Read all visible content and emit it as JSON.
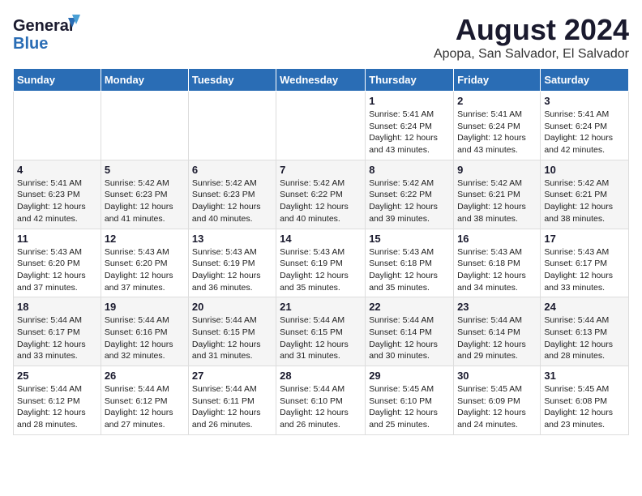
{
  "logo": {
    "line1": "General",
    "line2": "Blue"
  },
  "header": {
    "title": "August 2024",
    "location": "Apopa, San Salvador, El Salvador"
  },
  "weekdays": [
    "Sunday",
    "Monday",
    "Tuesday",
    "Wednesday",
    "Thursday",
    "Friday",
    "Saturday"
  ],
  "weeks": [
    [
      {
        "day": "",
        "info": ""
      },
      {
        "day": "",
        "info": ""
      },
      {
        "day": "",
        "info": ""
      },
      {
        "day": "",
        "info": ""
      },
      {
        "day": "1",
        "info": "Sunrise: 5:41 AM\nSunset: 6:24 PM\nDaylight: 12 hours\nand 43 minutes."
      },
      {
        "day": "2",
        "info": "Sunrise: 5:41 AM\nSunset: 6:24 PM\nDaylight: 12 hours\nand 43 minutes."
      },
      {
        "day": "3",
        "info": "Sunrise: 5:41 AM\nSunset: 6:24 PM\nDaylight: 12 hours\nand 42 minutes."
      }
    ],
    [
      {
        "day": "4",
        "info": "Sunrise: 5:41 AM\nSunset: 6:23 PM\nDaylight: 12 hours\nand 42 minutes."
      },
      {
        "day": "5",
        "info": "Sunrise: 5:42 AM\nSunset: 6:23 PM\nDaylight: 12 hours\nand 41 minutes."
      },
      {
        "day": "6",
        "info": "Sunrise: 5:42 AM\nSunset: 6:23 PM\nDaylight: 12 hours\nand 40 minutes."
      },
      {
        "day": "7",
        "info": "Sunrise: 5:42 AM\nSunset: 6:22 PM\nDaylight: 12 hours\nand 40 minutes."
      },
      {
        "day": "8",
        "info": "Sunrise: 5:42 AM\nSunset: 6:22 PM\nDaylight: 12 hours\nand 39 minutes."
      },
      {
        "day": "9",
        "info": "Sunrise: 5:42 AM\nSunset: 6:21 PM\nDaylight: 12 hours\nand 38 minutes."
      },
      {
        "day": "10",
        "info": "Sunrise: 5:42 AM\nSunset: 6:21 PM\nDaylight: 12 hours\nand 38 minutes."
      }
    ],
    [
      {
        "day": "11",
        "info": "Sunrise: 5:43 AM\nSunset: 6:20 PM\nDaylight: 12 hours\nand 37 minutes."
      },
      {
        "day": "12",
        "info": "Sunrise: 5:43 AM\nSunset: 6:20 PM\nDaylight: 12 hours\nand 37 minutes."
      },
      {
        "day": "13",
        "info": "Sunrise: 5:43 AM\nSunset: 6:19 PM\nDaylight: 12 hours\nand 36 minutes."
      },
      {
        "day": "14",
        "info": "Sunrise: 5:43 AM\nSunset: 6:19 PM\nDaylight: 12 hours\nand 35 minutes."
      },
      {
        "day": "15",
        "info": "Sunrise: 5:43 AM\nSunset: 6:18 PM\nDaylight: 12 hours\nand 35 minutes."
      },
      {
        "day": "16",
        "info": "Sunrise: 5:43 AM\nSunset: 6:18 PM\nDaylight: 12 hours\nand 34 minutes."
      },
      {
        "day": "17",
        "info": "Sunrise: 5:43 AM\nSunset: 6:17 PM\nDaylight: 12 hours\nand 33 minutes."
      }
    ],
    [
      {
        "day": "18",
        "info": "Sunrise: 5:44 AM\nSunset: 6:17 PM\nDaylight: 12 hours\nand 33 minutes."
      },
      {
        "day": "19",
        "info": "Sunrise: 5:44 AM\nSunset: 6:16 PM\nDaylight: 12 hours\nand 32 minutes."
      },
      {
        "day": "20",
        "info": "Sunrise: 5:44 AM\nSunset: 6:15 PM\nDaylight: 12 hours\nand 31 minutes."
      },
      {
        "day": "21",
        "info": "Sunrise: 5:44 AM\nSunset: 6:15 PM\nDaylight: 12 hours\nand 31 minutes."
      },
      {
        "day": "22",
        "info": "Sunrise: 5:44 AM\nSunset: 6:14 PM\nDaylight: 12 hours\nand 30 minutes."
      },
      {
        "day": "23",
        "info": "Sunrise: 5:44 AM\nSunset: 6:14 PM\nDaylight: 12 hours\nand 29 minutes."
      },
      {
        "day": "24",
        "info": "Sunrise: 5:44 AM\nSunset: 6:13 PM\nDaylight: 12 hours\nand 28 minutes."
      }
    ],
    [
      {
        "day": "25",
        "info": "Sunrise: 5:44 AM\nSunset: 6:12 PM\nDaylight: 12 hours\nand 28 minutes."
      },
      {
        "day": "26",
        "info": "Sunrise: 5:44 AM\nSunset: 6:12 PM\nDaylight: 12 hours\nand 27 minutes."
      },
      {
        "day": "27",
        "info": "Sunrise: 5:44 AM\nSunset: 6:11 PM\nDaylight: 12 hours\nand 26 minutes."
      },
      {
        "day": "28",
        "info": "Sunrise: 5:44 AM\nSunset: 6:10 PM\nDaylight: 12 hours\nand 26 minutes."
      },
      {
        "day": "29",
        "info": "Sunrise: 5:45 AM\nSunset: 6:10 PM\nDaylight: 12 hours\nand 25 minutes."
      },
      {
        "day": "30",
        "info": "Sunrise: 5:45 AM\nSunset: 6:09 PM\nDaylight: 12 hours\nand 24 minutes."
      },
      {
        "day": "31",
        "info": "Sunrise: 5:45 AM\nSunset: 6:08 PM\nDaylight: 12 hours\nand 23 minutes."
      }
    ]
  ]
}
